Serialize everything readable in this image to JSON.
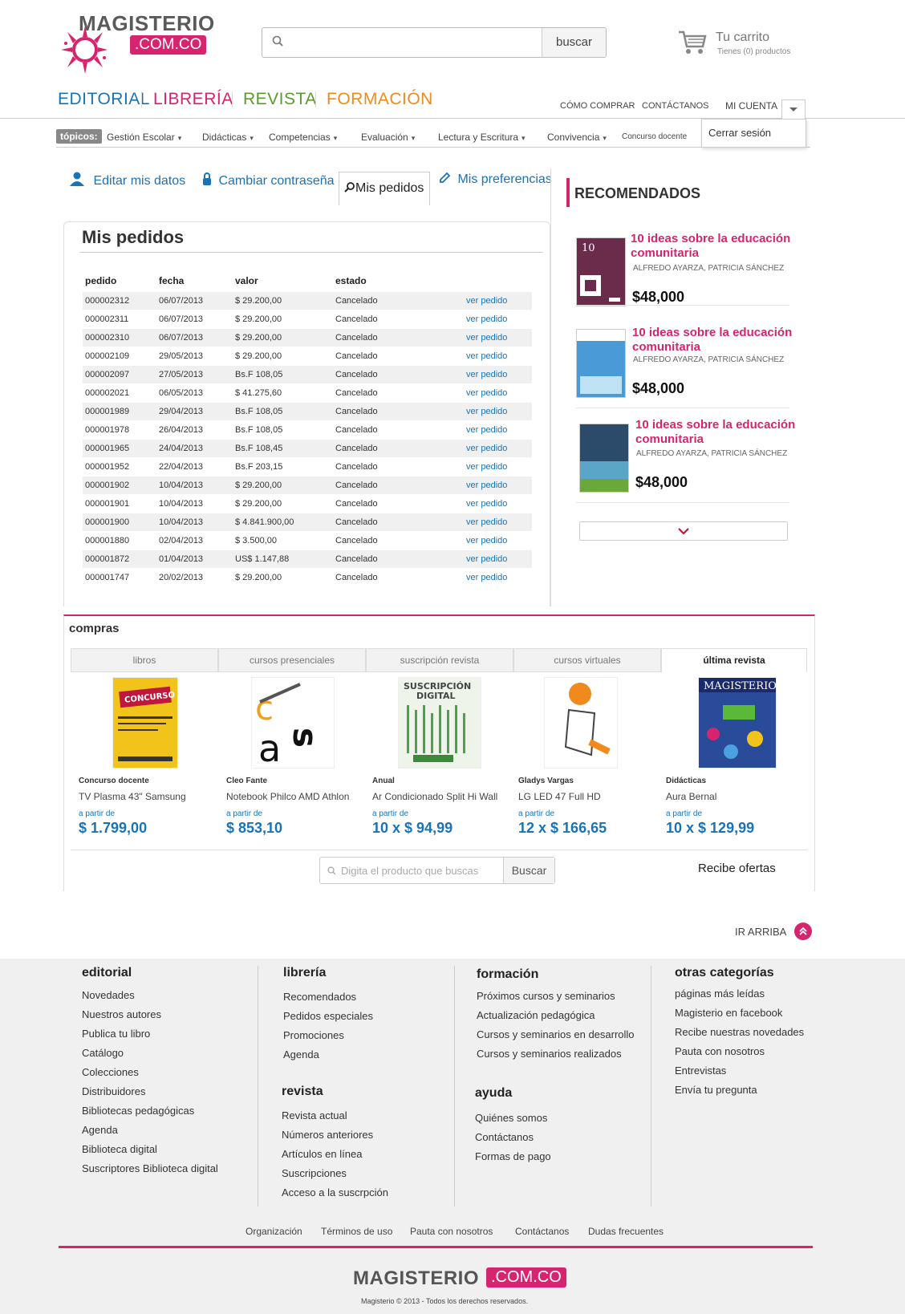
{
  "colors": {
    "accent": "#d6246e",
    "link": "#1a73b6"
  },
  "header": {
    "logo_word": "MAGISTERIO",
    "logo_box": ".COM.CO",
    "search_button": "buscar",
    "cart_title": "Tu carrito",
    "cart_sub": "Tienes (0) productos",
    "nav": {
      "editorial": "EDITORIAL",
      "libreria": "LIBRERÍA",
      "revista": "REVISTA",
      "formacion": "FORMACIÓN"
    },
    "links": {
      "como": "CÓMO COMPRAR",
      "contacto": "CONTÁCTANOS",
      "cuenta": "MI CUENTA"
    },
    "dropdown_item": "Cerrar sesión"
  },
  "topics": {
    "label": "tópicos:",
    "items": [
      "Gestión Escolar",
      "Didácticas",
      "Competencias",
      "Evaluación",
      "Lectura y Escritura",
      "Convivencia",
      "Concurso docente"
    ]
  },
  "tabs": {
    "edit": "Editar mis datos",
    "password": "Cambiar contraseña",
    "orders": "Mis pedidos",
    "prefs": "Mis preferencias"
  },
  "orders": {
    "title": "Mis pedidos",
    "columns": [
      "pedido",
      "fecha",
      "valor",
      "estado"
    ],
    "link_label": "ver pedido",
    "rows": [
      [
        "000002312",
        "06/07/2013",
        "$ 29.200,00",
        "Cancelado"
      ],
      [
        "000002311",
        "06/07/2013",
        "$ 29.200,00",
        "Cancelado"
      ],
      [
        "000002310",
        "06/07/2013",
        "$ 29.200,00",
        "Cancelado"
      ],
      [
        "000002109",
        "29/05/2013",
        "$ 29.200,00",
        "Cancelado"
      ],
      [
        "000002097",
        "27/05/2013",
        "Bs.F 108,05",
        "Cancelado"
      ],
      [
        "000002021",
        "06/05/2013",
        "$ 41.275,60",
        "Cancelado"
      ],
      [
        "000001989",
        "29/04/2013",
        "Bs.F 108,05",
        "Cancelado"
      ],
      [
        "000001978",
        "26/04/2013",
        "Bs.F 108,05",
        "Cancelado"
      ],
      [
        "000001965",
        "24/04/2013",
        "Bs.F 108,45",
        "Cancelado"
      ],
      [
        "000001952",
        "22/04/2013",
        "Bs.F 203,15",
        "Cancelado"
      ],
      [
        "000001902",
        "10/04/2013",
        "$ 29.200,00",
        "Cancelado"
      ],
      [
        "000001901",
        "10/04/2013",
        "$ 29.200,00",
        "Cancelado"
      ],
      [
        "000001900",
        "10/04/2013",
        "$ 4.841.900,00",
        "Cancelado"
      ],
      [
        "000001880",
        "02/04/2013",
        "$ 3.500,00",
        "Cancelado"
      ],
      [
        "000001872",
        "01/04/2013",
        "US$ 1.147,88",
        "Cancelado"
      ],
      [
        "000001747",
        "20/02/2013",
        "$ 29.200,00",
        "Cancelado"
      ]
    ]
  },
  "recommended": {
    "title": "RECOMENDADOS",
    "items": [
      {
        "title": "10 ideas sobre la educación comunitaria",
        "author": "ALFREDO AYARZA, PATRICIA SÁNCHEZ",
        "price": "$48,000"
      },
      {
        "title": "10 ideas sobre la educación comunitaria",
        "author": "ALFREDO AYARZA, PATRICIA SÁNCHEZ",
        "price": "$48,000"
      },
      {
        "title": "10 ideas sobre la educación comunitaria",
        "author": "ALFREDO AYARZA, PATRICIA SÁNCHEZ",
        "price": "$48,000"
      }
    ]
  },
  "compras": {
    "title": "compras",
    "tabs": [
      "libros",
      "cursos presenciales",
      "suscripción revista",
      "cursos virtuales",
      "última revista"
    ],
    "products": [
      {
        "cat": "Concurso docente",
        "name": "TV Plasma 43\" Samsung",
        "from": "a partir de",
        "price": "$ 1.799,00"
      },
      {
        "cat": "Cleo Fante",
        "name": "Notebook Philco AMD Athlon",
        "from": "a partir de",
        "price": "$ 853,10"
      },
      {
        "cat": "Anual",
        "name": "Ar Condicionado Split Hi Wall",
        "from": "a partir de",
        "price": "10 x $ 94,99"
      },
      {
        "cat": "Gladys Vargas",
        "name": "LG LED 47 Full HD",
        "from": "a partir de",
        "price": "12 x $ 166,65"
      },
      {
        "cat": "Didácticas",
        "name": "Aura Bernal",
        "from": "a partir de",
        "price": "10 x $ 129,99"
      }
    ],
    "search_placeholder": "Digita el producto que buscas",
    "search_button": "Buscar",
    "offers": "Recibe ofertas"
  },
  "ir_arriba": "IR ARRIBA",
  "footer": {
    "editorial": {
      "title": "editorial",
      "links": [
        "Novedades",
        "Nuestros autores",
        "Publica tu libro",
        "Catálogo",
        "Colecciones",
        "Distribuidores",
        "Bibliotecas pedagógicas",
        "Agenda",
        "Biblioteca digital",
        "Suscriptores Biblioteca digital"
      ]
    },
    "libreria": {
      "title": "librería",
      "links": [
        "Recomendados",
        "Pedidos especiales",
        "Promociones",
        "Agenda"
      ]
    },
    "revista": {
      "title": "revista",
      "links": [
        "Revista actual",
        "Números anteriores",
        "Artículos en línea",
        "Suscripciones",
        "Acceso a la suscrpción"
      ]
    },
    "formacion": {
      "title": "formación",
      "links": [
        "Próximos cursos y seminarios",
        "Actualización pedagógica",
        "Cursos y seminarios en desarrollo",
        "Cursos y seminarios realizados"
      ]
    },
    "ayuda": {
      "title": "ayuda",
      "links": [
        "Quiénes somos",
        "Contáctanos",
        "Formas de pago"
      ]
    },
    "otras": {
      "title": "otras categorías",
      "links": [
        "páginas más leídas",
        "Magisterio en facebook",
        "Recibe nuestras novedades",
        "Pauta con nosotros",
        "Entrevistas",
        "Envía tu pregunta"
      ]
    },
    "bottom_links": [
      "Organización",
      "Términos de uso",
      "Pauta con nosotros",
      "Contáctanos",
      "Dudas frecuentes"
    ],
    "logo_word": "MAGISTERIO",
    "logo_box": ".COM.CO",
    "copyright": "Magisterio © 2013 - Todos los derechos reservados."
  }
}
